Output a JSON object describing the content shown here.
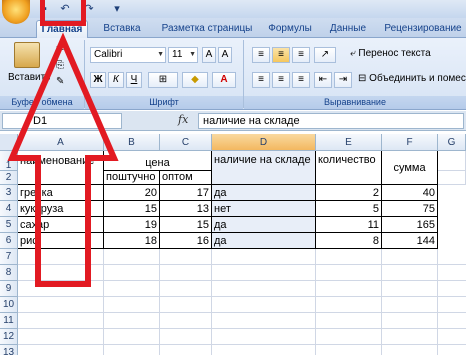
{
  "quick_access": {
    "icons": [
      "save-icon",
      "undo-icon",
      "redo-icon",
      "customize-icon"
    ]
  },
  "tabs": [
    "Главная",
    "Вставка",
    "Разметка страницы",
    "Формулы",
    "Данные",
    "Рецензирование"
  ],
  "ribbon": {
    "clipboard": {
      "label": "Буфер обмена",
      "paste": "Вставить"
    },
    "font": {
      "label": "Шрифт",
      "name": "Calibri",
      "size": "11",
      "bold": "Ж",
      "italic": "К",
      "underline": "Ч"
    },
    "alignment": {
      "label": "Выравнивание",
      "wrap_text": "Перенос текста",
      "merge": "Объединить и помест"
    }
  },
  "formula_bar": {
    "name_box": "D1",
    "fx": "fx",
    "formula": "наличие на складе"
  },
  "columns": [
    "A",
    "B",
    "C",
    "D",
    "E",
    "F",
    "G"
  ],
  "rows": [
    "1",
    "2",
    "3",
    "4",
    "5",
    "6",
    "7",
    "8",
    "9",
    "10",
    "11",
    "12",
    "13"
  ],
  "sheet": {
    "a1": "наименование",
    "price": "цена",
    "d1": "наличие на складе",
    "e1": "количество",
    "f1": "сумма",
    "b2": "поштучно",
    "c2": "оптом",
    "data": [
      {
        "a": "гречка",
        "b": "20",
        "c": "17",
        "d": "да",
        "e": "2",
        "f": "40"
      },
      {
        "a": "кукуруза",
        "b": "15",
        "c": "13",
        "d": "нет",
        "e": "5",
        "f": "75"
      },
      {
        "a": "сахар",
        "b": "19",
        "c": "15",
        "d": "да",
        "e": "11",
        "f": "165"
      },
      {
        "a": "рис",
        "b": "18",
        "c": "16",
        "d": "да",
        "e": "8",
        "f": "144"
      }
    ]
  },
  "colors": {
    "annotation": "#e21a22",
    "ribbon": "#d6e3f4"
  }
}
